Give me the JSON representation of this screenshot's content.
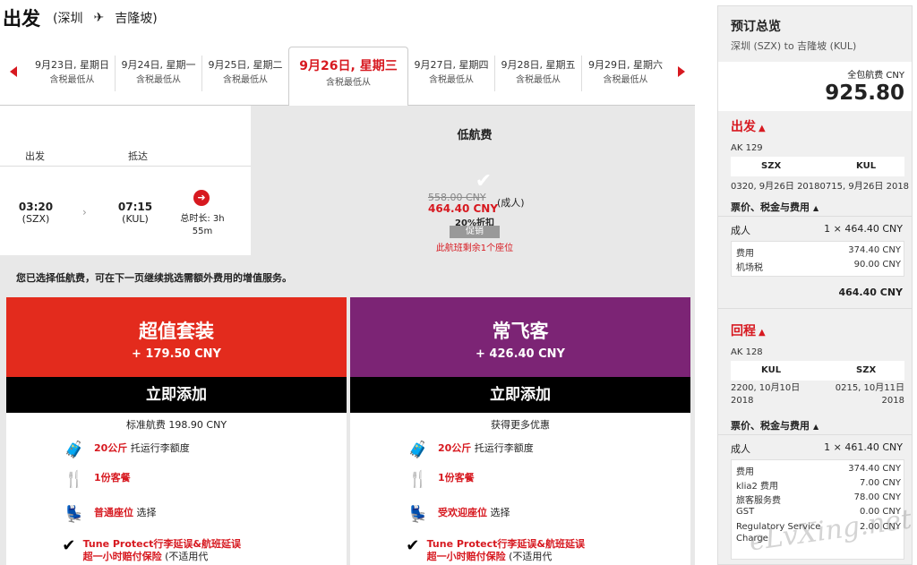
{
  "header": {
    "title": "出发",
    "from": "(深圳",
    "plane_icon": "plane-icon",
    "to": "吉隆坡)"
  },
  "dates": [
    {
      "date": "9月23日, 星期日",
      "sub": "含税最低从"
    },
    {
      "date": "9月24日, 星期一",
      "sub": "含税最低从"
    },
    {
      "date": "9月25日, 星期二",
      "sub": "含税最低从"
    },
    {
      "date": "9月26日, 星期三",
      "sub": "含税最低从"
    },
    {
      "date": "9月27日, 星期四",
      "sub": "含税最低从"
    },
    {
      "date": "9月28日, 星期五",
      "sub": "含税最低从"
    },
    {
      "date": "9月29日, 星期六",
      "sub": "含税最低从"
    }
  ],
  "columns": {
    "depart": "出发",
    "arrive": "抵达",
    "low_fare": "低航费"
  },
  "flight": {
    "dep_time": "03:20",
    "dep_code": "(SZX)",
    "arr_time": "07:15",
    "arr_code": "(KUL)",
    "duration": "总时长: 3h 55m"
  },
  "fare": {
    "old": "558.00 CNY",
    "new": "464.40 CNY",
    "adult": "(成人)",
    "discount": "20%折扣",
    "promo": "促销",
    "seats": "此航班剩余1个座位"
  },
  "note": "您已选择低航费，可在下一页继续挑选需额外费用的增值服务。",
  "bundles": [
    {
      "name": "超值套装",
      "price": "+ 179.50 CNY",
      "button": "立即添加",
      "sub": "标准航费 198.90 CNY",
      "features": [
        {
          "em": "20公斤",
          "text": " 托运行李额度"
        },
        {
          "em": "1份客餐",
          "text": ""
        },
        {
          "em": "普通座位",
          "text": " 选择"
        },
        {
          "em": "Tune Protect行李延误&航班延误超一小时赔付保险",
          "text": " (不适用代"
        }
      ]
    },
    {
      "name": "常飞客",
      "price": "+ 426.40 CNY",
      "button": "立即添加",
      "sub": "获得更多优惠",
      "features": [
        {
          "em": "20公斤",
          "text": " 托运行李额度"
        },
        {
          "em": "1份客餐",
          "text": ""
        },
        {
          "em": "受欢迎座位",
          "text": " 选择"
        },
        {
          "em": "Tune Protect行李延误&航班延误超一小时赔付保险",
          "text": " (不适用代"
        }
      ]
    }
  ],
  "summary": {
    "title": "预订总览",
    "route": "深圳 (SZX) to 吉隆坡 (KUL)",
    "total_label": "全包航费 CNY",
    "total": "925.80",
    "outbound": {
      "section": "出发",
      "flight": "AK 129",
      "from": "SZX",
      "to": "KUL",
      "times": "0320, 9月26日 20180715, 9月26日 2018",
      "fees_title": "票价、税金与费用",
      "adult": "成人",
      "adult_val": "1 × 464.40 CNY",
      "breakdown": [
        {
          "label": "费用",
          "value": "374.40 CNY"
        },
        {
          "label": "机场税",
          "value": "90.00 CNY"
        }
      ],
      "subtotal": "464.40 CNY"
    },
    "return": {
      "section": "回程",
      "flight": "AK 128",
      "from": "KUL",
      "to": "SZX",
      "time_from": "2200, 10月10日 2018",
      "time_to": "0215, 10月11日 2018",
      "fees_title": "票价、税金与费用",
      "adult": "成人",
      "adult_val": "1 × 461.40 CNY",
      "breakdown": [
        {
          "label": "费用",
          "value": "374.40 CNY"
        },
        {
          "label": "klia2 费用",
          "value": "7.00 CNY"
        },
        {
          "label": "旅客服务费",
          "value": "78.00 CNY"
        },
        {
          "label": "GST",
          "value": "0.00 CNY"
        },
        {
          "label": "Regulatory Service Charge",
          "value": "2.00 CNY"
        }
      ]
    }
  },
  "watermark": "eLvXing.net"
}
